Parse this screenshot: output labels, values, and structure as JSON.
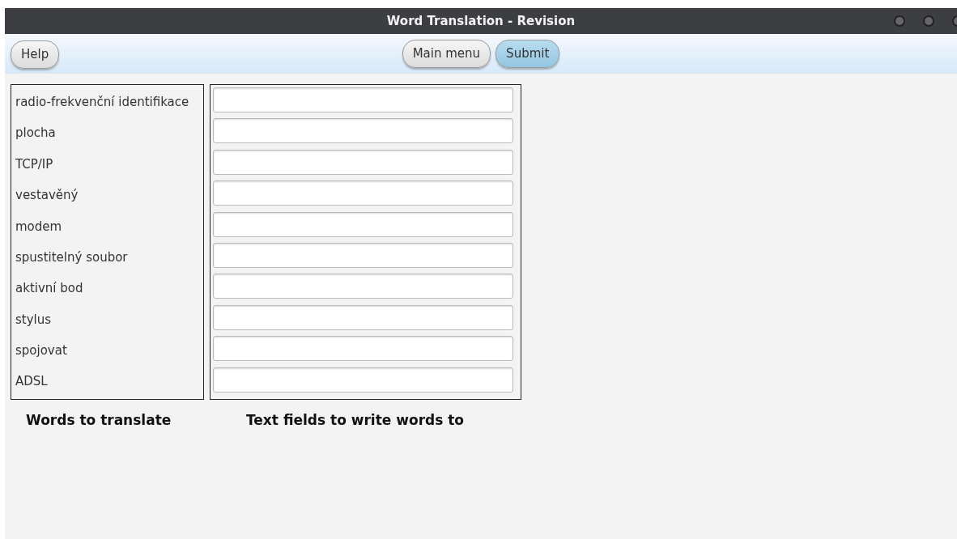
{
  "window": {
    "title": "Word Translation - Revision"
  },
  "toolbar": {
    "left_buttons": [
      {
        "label": "Help",
        "kind": "plain"
      }
    ],
    "center_buttons": [
      {
        "label": "Main menu",
        "kind": "plain"
      },
      {
        "label": "Submit",
        "kind": "primary"
      }
    ]
  },
  "words": [
    "radio-frekvenční identifikace",
    "plocha",
    "TCP/IP",
    "vestavěný",
    "modem",
    "spustitelný soubor",
    "aktivní bod",
    "stylus",
    "spojovat",
    "ADSL"
  ],
  "captions": {
    "words": "Words to translate",
    "fields": "Text fields to write words to"
  }
}
